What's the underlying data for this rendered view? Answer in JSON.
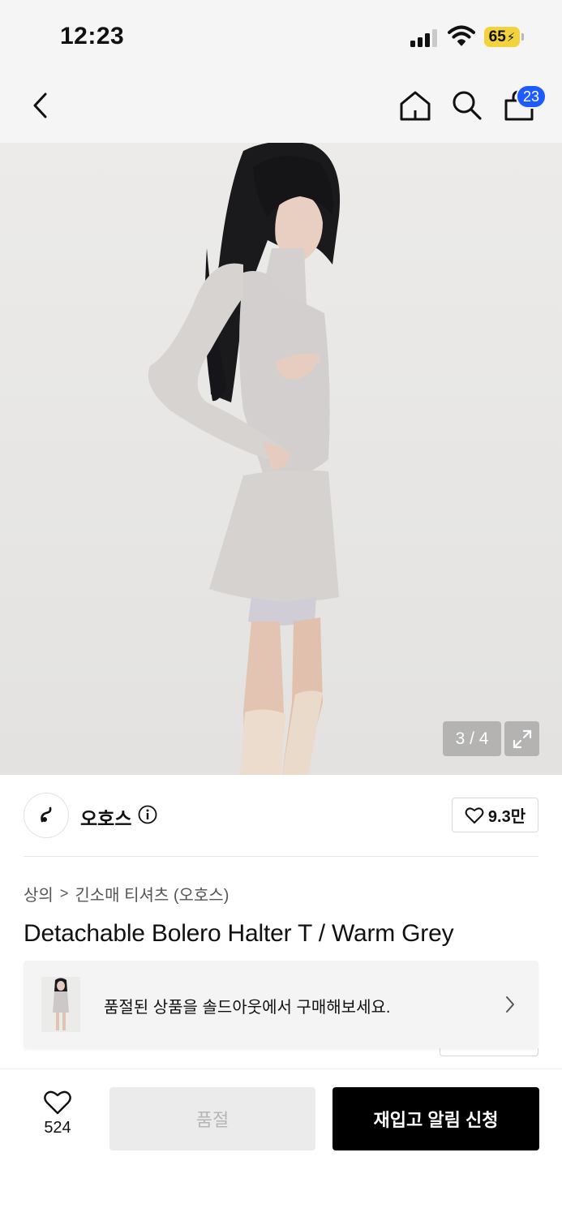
{
  "status_bar": {
    "time": "12:23",
    "battery": "65"
  },
  "nav": {
    "back_icon": "chevron-left-icon",
    "home_icon": "home-icon",
    "search_icon": "search-icon",
    "cart_icon": "shopping-bag-icon",
    "cart_count": "23"
  },
  "gallery": {
    "pager": "3 / 4",
    "expand_icon": "expand-icon"
  },
  "brand": {
    "name": "오호스",
    "info_icon": "info-icon",
    "likes": "9.3만"
  },
  "breadcrumb": {
    "category": "상의",
    "subcategory": "긴소매 티셔츠 (오호스)"
  },
  "product": {
    "title": "Detachable Bolero Halter T / Warm Grey"
  },
  "banner": {
    "text": "품절된 상품을 솔드아웃에서 구매해보세요."
  },
  "bottom_bar": {
    "wish_count": "524",
    "soldout_label": "품절",
    "restock_label": "재입고 알림 신청"
  },
  "colors": {
    "accent_badge": "#1e5bff",
    "primary_button": "#000000",
    "disabled_button": "#ebebeb",
    "battery": "#f2d33c"
  }
}
